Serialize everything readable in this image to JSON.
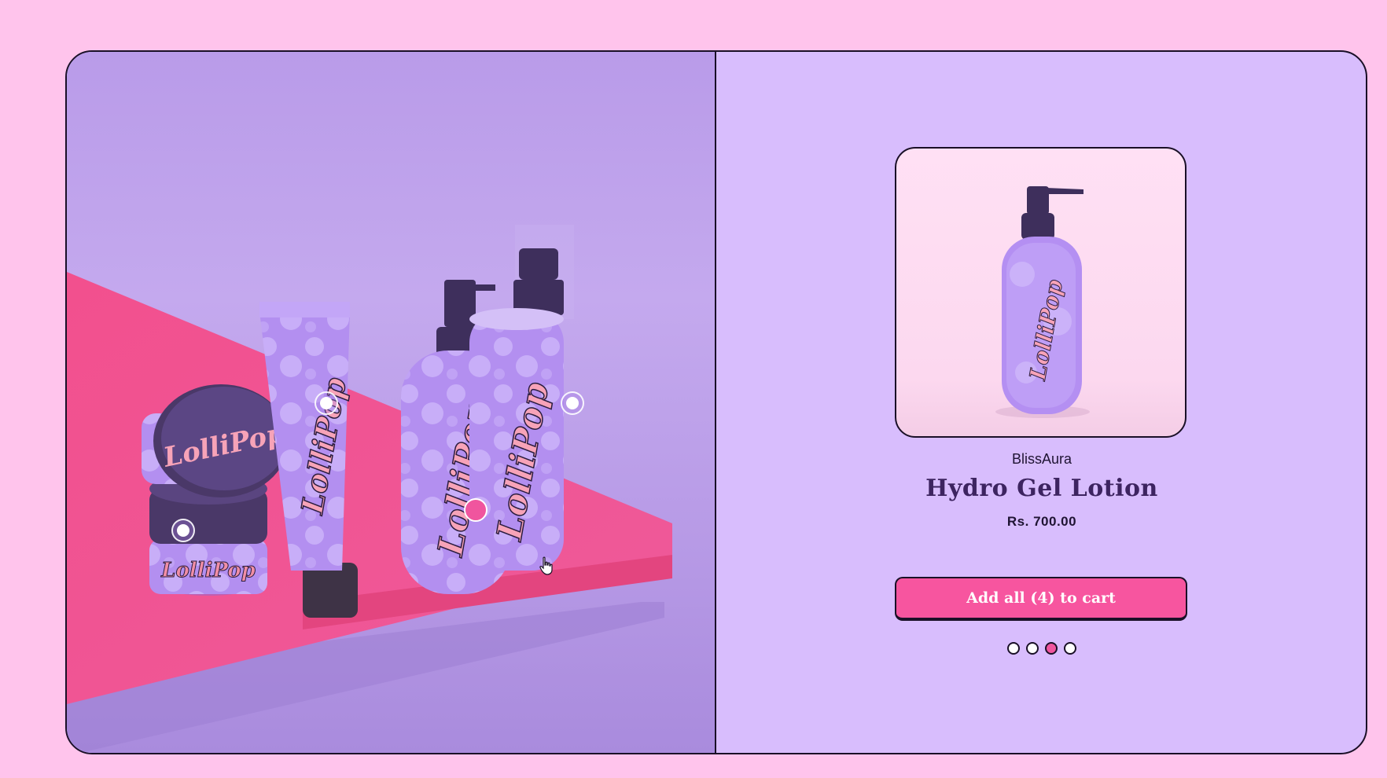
{
  "colors": {
    "page_bg": "#ffc4ec",
    "panel_bg": "#d8bdfd",
    "accent_pink": "#f7559f",
    "title_purple": "#3d2460"
  },
  "scene": {
    "logo_text": "LolliPop",
    "hotspots": [
      {
        "name": "hotspot-jar",
        "active": false
      },
      {
        "name": "hotspot-tube",
        "active": false
      },
      {
        "name": "hotspot-pump-bottle",
        "active": true
      },
      {
        "name": "hotspot-spray-bottle",
        "active": false
      }
    ]
  },
  "product": {
    "brand": "BlissAura",
    "title": "Hydro Gel Lotion",
    "price": "Rs. 700.00",
    "add_to_cart_label": "Add all (4) to cart"
  },
  "pager": {
    "count": 4,
    "active_index": 2
  }
}
